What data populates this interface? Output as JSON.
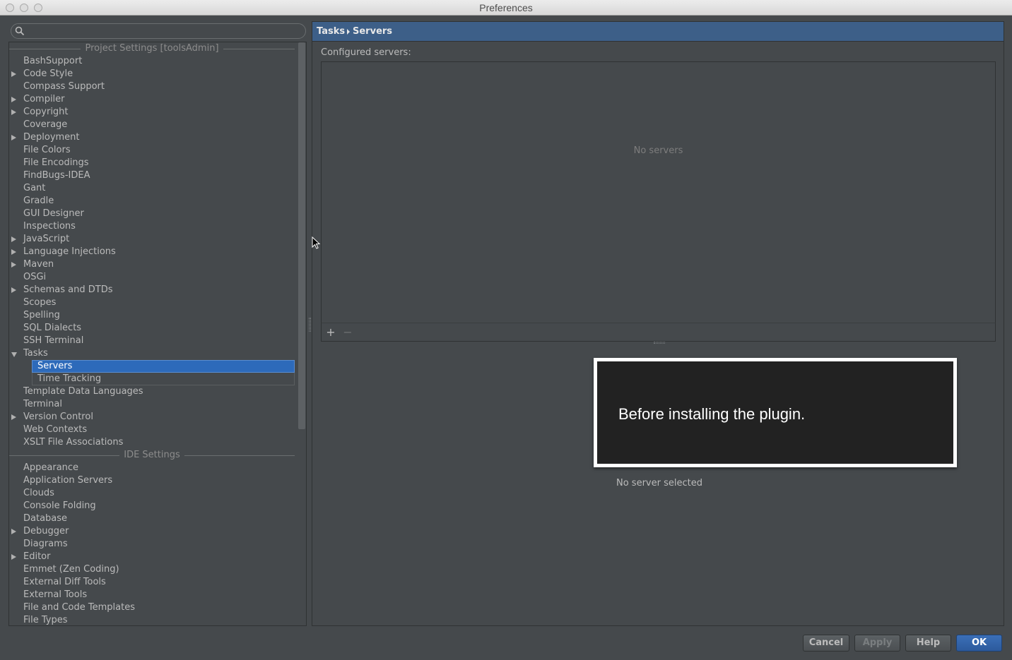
{
  "window": {
    "title": "Preferences"
  },
  "search": {
    "placeholder": ""
  },
  "tree": {
    "project_header": "Project Settings [toolsAdmin]",
    "project_items": [
      {
        "label": "BashSupport",
        "expandable": false
      },
      {
        "label": "Code Style",
        "expandable": true
      },
      {
        "label": "Compass Support",
        "expandable": false
      },
      {
        "label": "Compiler",
        "expandable": true
      },
      {
        "label": "Copyright",
        "expandable": true
      },
      {
        "label": "Coverage",
        "expandable": false
      },
      {
        "label": "Deployment",
        "expandable": true
      },
      {
        "label": "File Colors",
        "expandable": false
      },
      {
        "label": "File Encodings",
        "expandable": false
      },
      {
        "label": "FindBugs-IDEA",
        "expandable": false
      },
      {
        "label": "Gant",
        "expandable": false
      },
      {
        "label": "Gradle",
        "expandable": false
      },
      {
        "label": "GUI Designer",
        "expandable": false
      },
      {
        "label": "Inspections",
        "expandable": false
      },
      {
        "label": "JavaScript",
        "expandable": true
      },
      {
        "label": "Language Injections",
        "expandable": true
      },
      {
        "label": "Maven",
        "expandable": true
      },
      {
        "label": "OSGi",
        "expandable": false
      },
      {
        "label": "Schemas and DTDs",
        "expandable": true
      },
      {
        "label": "Scopes",
        "expandable": false
      },
      {
        "label": "Spelling",
        "expandable": false
      },
      {
        "label": "SQL Dialects",
        "expandable": false
      },
      {
        "label": "SSH Terminal",
        "expandable": false
      },
      {
        "label": "Tasks",
        "expandable": true,
        "expanded": true
      },
      {
        "label": "Servers",
        "child": true,
        "selected": true
      },
      {
        "label": "Time Tracking",
        "child": true
      },
      {
        "label": "Template Data Languages",
        "expandable": false
      },
      {
        "label": "Terminal",
        "expandable": false
      },
      {
        "label": "Version Control",
        "expandable": true
      },
      {
        "label": "Web Contexts",
        "expandable": false
      },
      {
        "label": "XSLT File Associations",
        "expandable": false
      }
    ],
    "ide_header": "IDE Settings",
    "ide_items": [
      {
        "label": "Appearance",
        "expandable": false
      },
      {
        "label": "Application Servers",
        "expandable": false
      },
      {
        "label": "Clouds",
        "expandable": false
      },
      {
        "label": "Console Folding",
        "expandable": false
      },
      {
        "label": "Database",
        "expandable": false
      },
      {
        "label": "Debugger",
        "expandable": true
      },
      {
        "label": "Diagrams",
        "expandable": false
      },
      {
        "label": "Editor",
        "expandable": true
      },
      {
        "label": "Emmet (Zen Coding)",
        "expandable": false
      },
      {
        "label": "External Diff Tools",
        "expandable": false
      },
      {
        "label": "External Tools",
        "expandable": false
      },
      {
        "label": "File and Code Templates",
        "expandable": false
      },
      {
        "label": "File Types",
        "expandable": false
      }
    ]
  },
  "breadcrumb": {
    "parent": "Tasks",
    "current": "Servers"
  },
  "main": {
    "configured_label": "Configured servers:",
    "empty_text": "No servers",
    "add_label": "+",
    "remove_label": "−",
    "no_selection_text": "No server selected"
  },
  "caption": {
    "text": "Before installing the plugin."
  },
  "buttons": {
    "cancel": "Cancel",
    "apply": "Apply",
    "help": "Help",
    "ok": "OK"
  },
  "colors": {
    "background": "#45494c",
    "selection": "#2d6aba",
    "breadcrumb_bg": "#3d5f88",
    "primary_button": "#2c5a9c"
  }
}
